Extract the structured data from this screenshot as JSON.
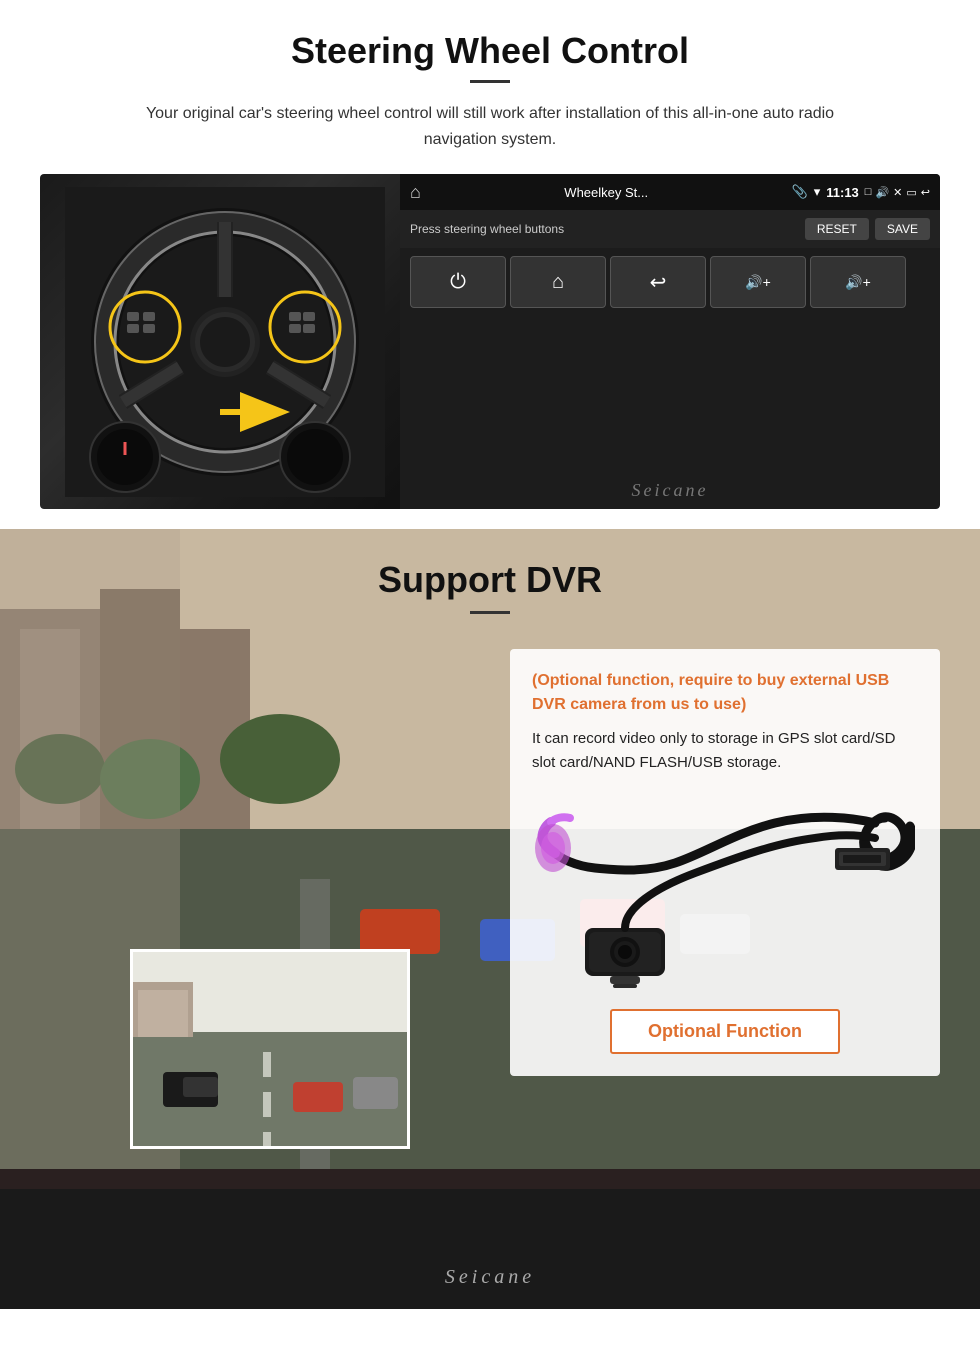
{
  "steering": {
    "title": "Steering Wheel Control",
    "subtitle": "Your original car's steering wheel control will still work after installation of this all-in-one auto radio navigation system.",
    "android_title": "Wheelkey St...",
    "android_time": "11:13",
    "hint_text": "Press steering wheel buttons",
    "btn_reset": "RESET",
    "btn_save": "SAVE",
    "seicane": "Seicane",
    "keys": [
      "⏻",
      "⌂",
      "↩",
      "🔊+",
      "🔊+"
    ]
  },
  "dvr": {
    "title": "Support DVR",
    "optional_text": "(Optional function, require to buy external USB DVR camera from us to use)",
    "description": "It can record video only to storage in GPS slot card/SD slot card/NAND FLASH/USB storage.",
    "optional_function_label": "Optional Function",
    "seicane": "Seicane"
  }
}
